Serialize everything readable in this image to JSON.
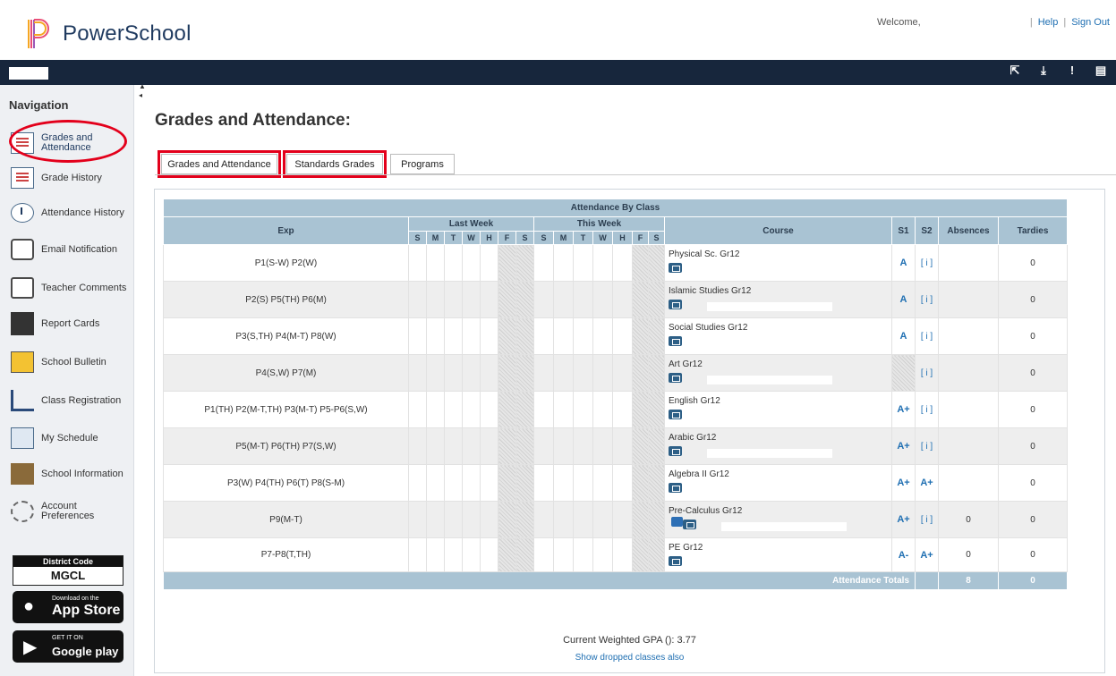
{
  "header": {
    "brand": "PowerSchool",
    "welcome": "Welcome,",
    "links": [
      "Help",
      "Sign Out"
    ]
  },
  "toolbar_icons": [
    "external-link-icon",
    "download-icon",
    "alert-icon",
    "print-icon"
  ],
  "sidebar": {
    "heading": "Navigation",
    "items": [
      {
        "label": "Grades and Attendance",
        "icon": "grades-icon"
      },
      {
        "label": "Grade History",
        "icon": "grade-history-icon"
      },
      {
        "label": "Attendance History",
        "icon": "attendance-history-icon"
      },
      {
        "label": "Email Notification",
        "icon": "email-icon"
      },
      {
        "label": "Teacher Comments",
        "icon": "comments-icon"
      },
      {
        "label": "Report Cards",
        "icon": "report-card-icon"
      },
      {
        "label": "School Bulletin",
        "icon": "bulletin-icon"
      },
      {
        "label": "Class Registration",
        "icon": "registration-icon"
      },
      {
        "label": "My Schedule",
        "icon": "schedule-icon"
      },
      {
        "label": "School Information",
        "icon": "school-icon"
      },
      {
        "label": "Account Preferences",
        "icon": "preferences-icon"
      }
    ],
    "district_code_label": "District Code",
    "district_code": "MGCL",
    "app_store_small": "Download on the",
    "app_store_big": "App Store",
    "google_small": "GET IT ON",
    "google_big": "Google play"
  },
  "main": {
    "title": "Grades and Attendance:",
    "tabs": [
      "Grades and Attendance",
      "Standards Grades",
      "Programs"
    ],
    "table": {
      "caption": "Attendance By Class",
      "col_exp": "Exp",
      "last_week": "Last Week",
      "this_week": "This Week",
      "days": [
        "S",
        "M",
        "T",
        "W",
        "H",
        "F",
        "S"
      ],
      "col_course": "Course",
      "col_s1": "S1",
      "col_s2": "S2",
      "col_absences": "Absences",
      "col_tardies": "Tardies",
      "rows": [
        {
          "exp": "P1(S-W) P2(W)",
          "course": "Physical Sc. Gr12",
          "s1": "A",
          "s2": "[ i ]",
          "absences": "",
          "tardies": "0"
        },
        {
          "exp": "P2(S) P5(TH) P6(M)",
          "course": "Islamic Studies Gr12",
          "s1": "A",
          "s2": "[ i ]",
          "absences": "",
          "tardies": "0"
        },
        {
          "exp": "P3(S,TH) P4(M-T) P8(W)",
          "course": "Social Studies Gr12",
          "s1": "A",
          "s2": "[ i ]",
          "absences": "",
          "tardies": "0"
        },
        {
          "exp": "P4(S,W) P7(M)",
          "course": "Art Gr12",
          "s1": "",
          "s2": "[ i ]",
          "absences": "",
          "tardies": "0"
        },
        {
          "exp": "P1(TH) P2(M-T,TH) P3(M-T) P5-P6(S,W)",
          "course": "English Gr12",
          "s1": "A+",
          "s2": "[ i ]",
          "absences": "",
          "tardies": "0"
        },
        {
          "exp": "P5(M-T) P6(TH) P7(S,W)",
          "course": "Arabic Gr12",
          "s1": "A+",
          "s2": "[ i ]",
          "absences": "",
          "tardies": "0"
        },
        {
          "exp": "P3(W) P4(TH) P6(T) P8(S-M)",
          "course": "Algebra II Gr12",
          "s1": "A+",
          "s2": "A+",
          "absences": "",
          "tardies": "0"
        },
        {
          "exp": "P9(M-T)",
          "course": "Pre-Calculus Gr12",
          "s1": "A+",
          "s2": "[ i ]",
          "absences": "0",
          "tardies": "0"
        },
        {
          "exp": "P7-P8(T,TH)",
          "course": "PE Gr12",
          "s1": "A-",
          "s2": "A+",
          "absences": "0",
          "tardies": "0"
        }
      ],
      "totals_label": "Attendance Totals",
      "totals_absences": "8",
      "totals_tardies": "0"
    },
    "gpa": "Current Weighted GPA (): 3.77",
    "dropped_link": "Show dropped classes also"
  }
}
